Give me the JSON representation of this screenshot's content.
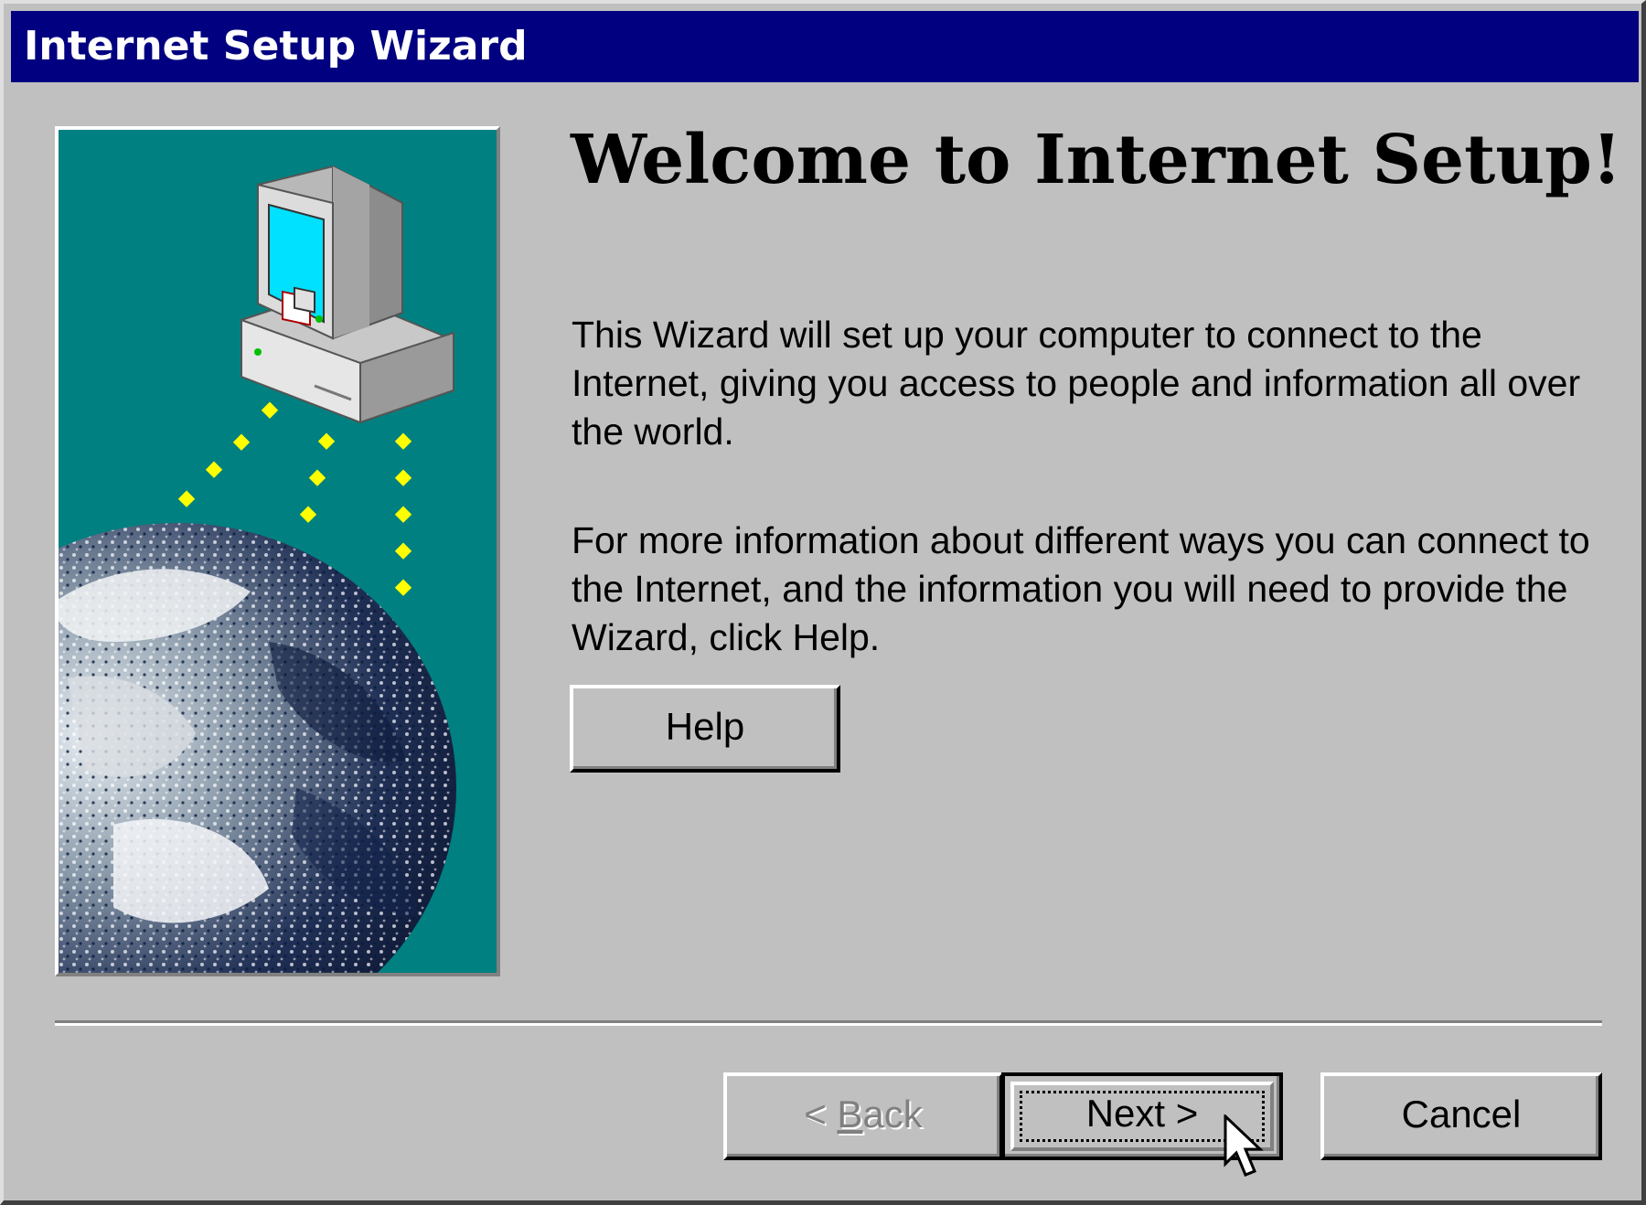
{
  "window": {
    "title": "Internet Setup Wizard"
  },
  "welcome": {
    "heading": "Welcome to Internet Setup!",
    "paragraph1": "This Wizard will set up your computer to connect to the Internet, giving you access to people and information all over the world.",
    "paragraph2": "For more information about different ways you can connect to the Internet, and the information you will need to provide the Wizard, click Help."
  },
  "buttons": {
    "help": "Help",
    "back_prefix": "< ",
    "back_accel": "B",
    "back_rest": "ack",
    "back_enabled": false,
    "next": "Next >",
    "cancel": "Cancel"
  },
  "illustration": {
    "background_color": "#008080",
    "beam_color": "#ffff00",
    "icons": [
      "computer-icon",
      "globe-icon"
    ]
  },
  "colors": {
    "titlebar": "#000080",
    "face": "#c0c0c0"
  }
}
